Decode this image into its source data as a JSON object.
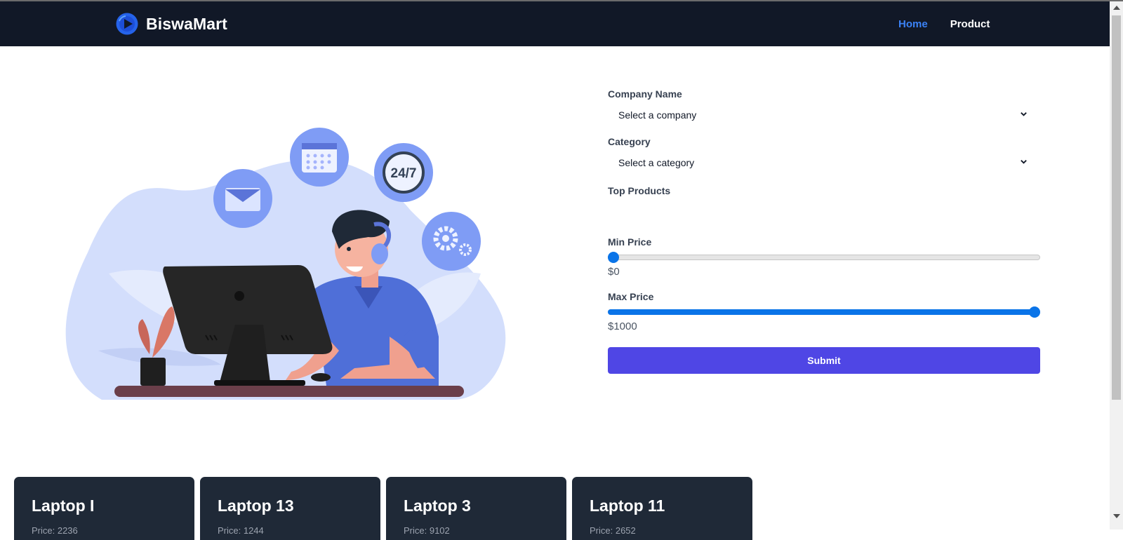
{
  "brand": {
    "name": "BiswaMart",
    "logo_icon": "play-logo-icon"
  },
  "nav": {
    "items": [
      {
        "label": "Home",
        "active": true
      },
      {
        "label": "Product",
        "active": false
      }
    ]
  },
  "hero": {
    "illustration": "customer-support-illustration",
    "badge_text": "24/7"
  },
  "form": {
    "company": {
      "label": "Company Name",
      "selected": "Select a company"
    },
    "category": {
      "label": "Category",
      "selected": "Select a category"
    },
    "top_products": {
      "label": "Top Products"
    },
    "min_price": {
      "label": "Min Price",
      "value_text": "$0",
      "value": 0,
      "max": 1000
    },
    "max_price": {
      "label": "Max Price",
      "value_text": "$1000",
      "value": 1000,
      "max": 1000
    },
    "submit_label": "Submit"
  },
  "products": [
    {
      "title": "Laptop I",
      "price": "Price: 2236"
    },
    {
      "title": "Laptop 13",
      "price": "Price: 1244"
    },
    {
      "title": "Laptop 3",
      "price": "Price: 9102"
    },
    {
      "title": "Laptop 11",
      "price": "Price: 2652"
    }
  ],
  "colors": {
    "navbar_bg": "#111827",
    "nav_active": "#3b82f6",
    "accent": "#4f46e5",
    "slider": "#0a74e8",
    "card_bg": "#1f2937"
  }
}
